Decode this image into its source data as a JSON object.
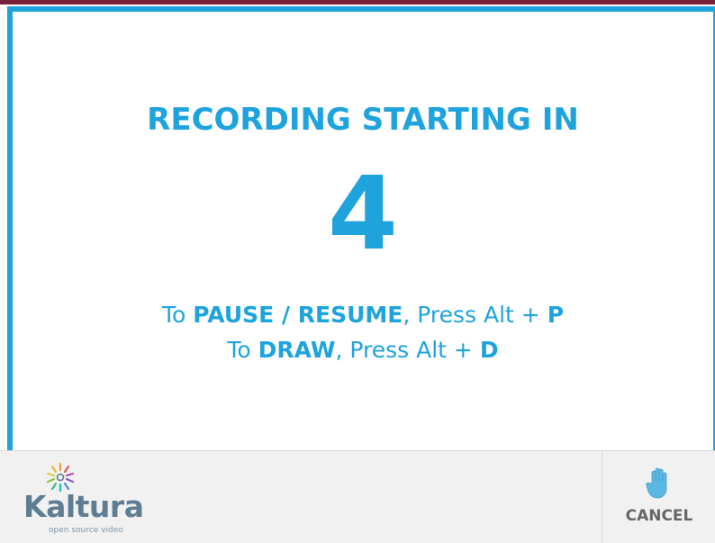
{
  "countdown": {
    "title": "RECORDING STARTING IN",
    "value": "4"
  },
  "shortcuts": [
    {
      "prefix": "To ",
      "action": "PAUSE / RESUME",
      "middle": ", Press Alt + ",
      "key": "P"
    },
    {
      "prefix": "To ",
      "action": "DRAW",
      "middle": ", Press Alt + ",
      "key": "D"
    }
  ],
  "footer": {
    "logo_word": "Kaltura",
    "logo_tagline": "open source video",
    "cancel_label": "CANCEL",
    "cancel_icon": "hand-stop-icon"
  },
  "colors": {
    "accent": "#1ea3dd",
    "logo": "#5e7d93",
    "cancel_text": "#666666",
    "footer_bg": "#f1f1f1"
  }
}
